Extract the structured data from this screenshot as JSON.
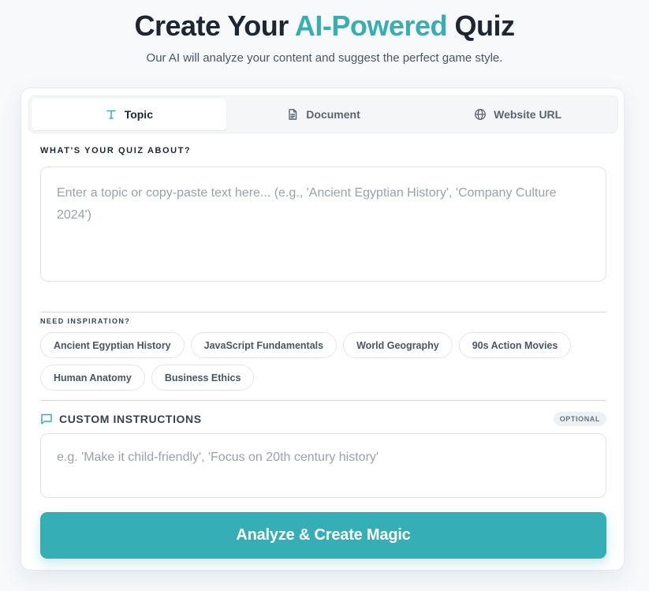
{
  "header": {
    "title_prefix": "Create Your",
    "title_accent": "AI-Powered",
    "title_suffix": "Quiz",
    "subtitle": "Our AI will analyze your content and suggest the perfect game style."
  },
  "tabs": [
    {
      "label": "Topic",
      "icon": "text-icon",
      "active": true
    },
    {
      "label": "Document",
      "icon": "document-icon",
      "active": false
    },
    {
      "label": "Website URL",
      "icon": "globe-icon",
      "active": false
    }
  ],
  "topic": {
    "label": "WHAT'S YOUR QUIZ ABOUT?",
    "value": "",
    "placeholder": "Enter a topic or copy-paste text here... (e.g., 'Ancient Egyptian History', 'Company Culture 2024')"
  },
  "inspiration": {
    "label": "NEED INSPIRATION?",
    "chips": [
      "Ancient Egyptian History",
      "JavaScript Fundamentals",
      "World Geography",
      "90s Action Movies",
      "Human Anatomy",
      "Business Ethics"
    ]
  },
  "custom_instructions": {
    "label": "CUSTOM INSTRUCTIONS",
    "badge": "OPTIONAL",
    "icon": "message-square-icon",
    "value": "",
    "placeholder": "e.g. 'Make it child-friendly', 'Focus on 20th century history'"
  },
  "cta": {
    "label": "Analyze & Create Magic"
  },
  "colors": {
    "accent": "#36aeb4",
    "button": "#35afb5",
    "title": "#1e2533",
    "divider": "#bfe6e8"
  }
}
